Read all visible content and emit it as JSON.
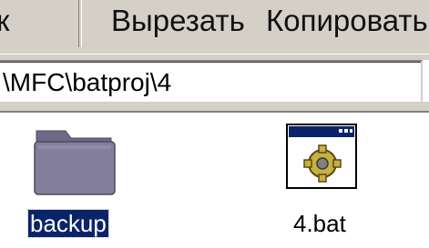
{
  "toolbar": {
    "items": [
      {
        "label": "к"
      },
      {
        "label": "Вырезать"
      },
      {
        "label": "Копировать"
      }
    ]
  },
  "address": {
    "value": "\\MFC\\batproj\\4"
  },
  "files": [
    {
      "name": "backup",
      "icon": "folder-icon",
      "selected": true
    },
    {
      "name": "4.bat",
      "icon": "batch-file-icon",
      "selected": false
    }
  ],
  "colors": {
    "chrome": "#d4d0c8",
    "selection": "#0a246a",
    "folder": "#807c98"
  }
}
